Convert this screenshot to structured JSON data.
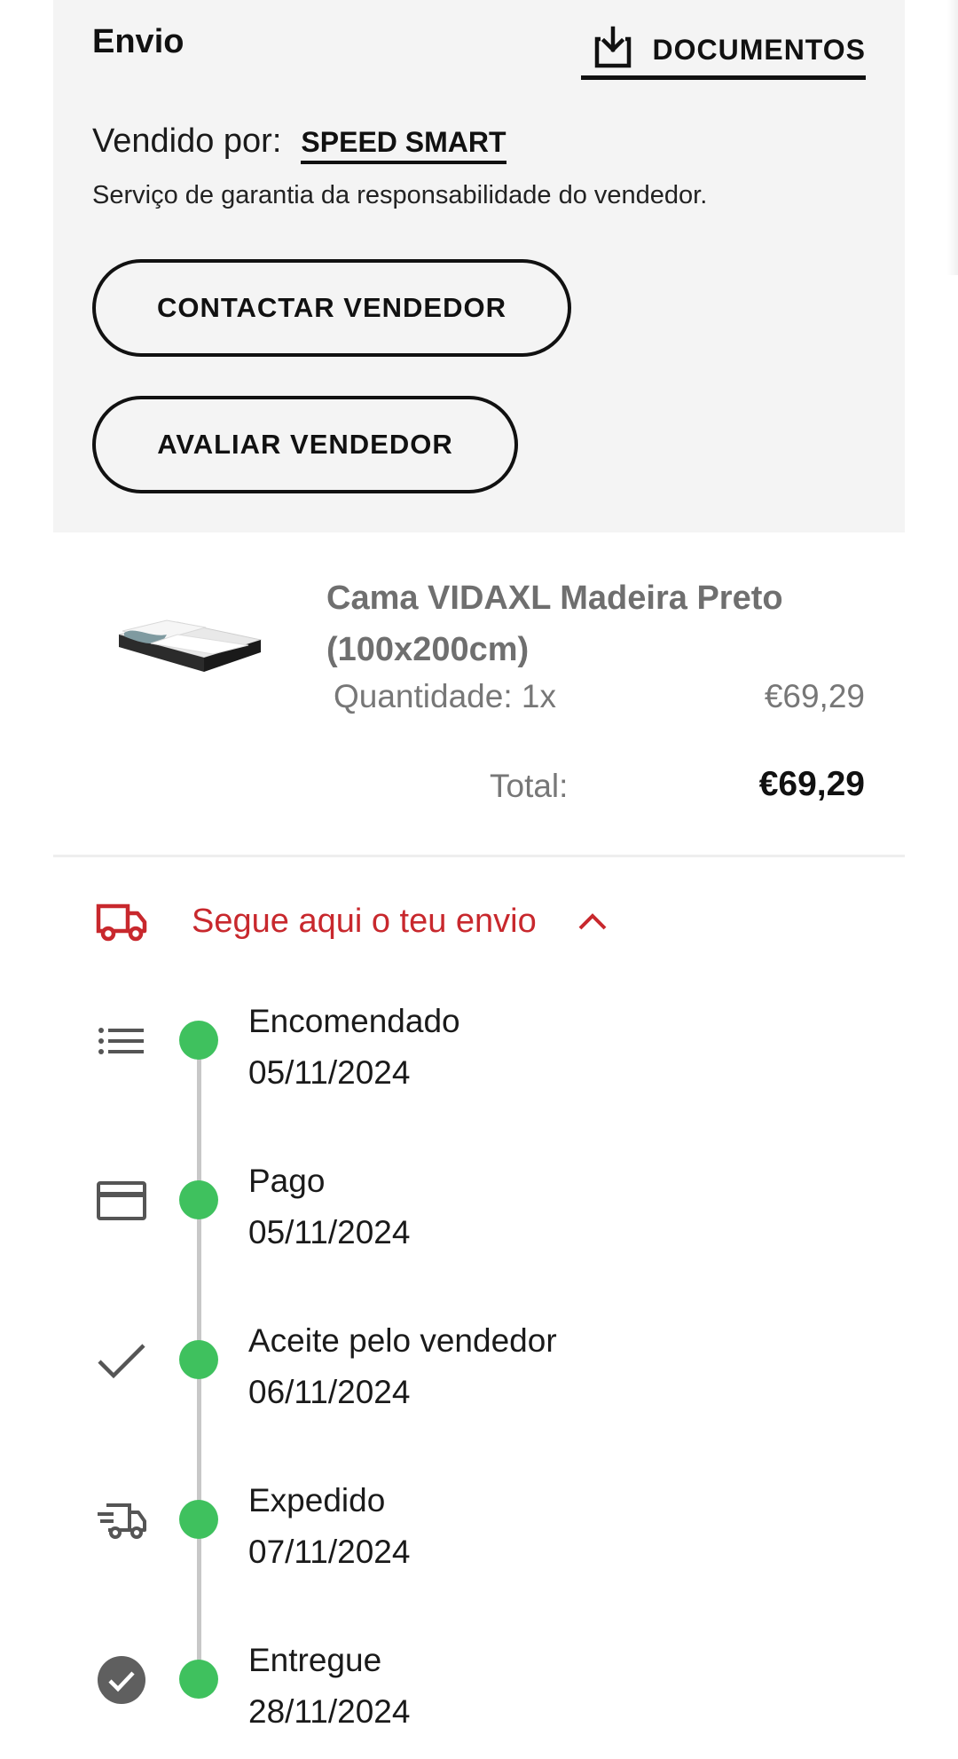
{
  "shipment": {
    "title": "Envio",
    "documents_label": "DOCUMENTOS",
    "sold_by_label": "Vendido por:",
    "seller_name": "SPEED SMART",
    "warranty_text": "Serviço de garantia da responsabilidade do vendedor.",
    "contact_button": "CONTACTAR VENDEDOR",
    "rate_button": "AVALIAR VENDEDOR"
  },
  "product": {
    "title": "Cama VIDAXL Madeira Preto (100x200cm)",
    "quantity": "Quantidade: 1x",
    "unit_price": "€69,29",
    "total_label": "Total:",
    "total_value": "€69,29"
  },
  "tracking": {
    "toggle_label": "Segue aqui o teu envio",
    "accent_color": "#c8282d",
    "dot_color": "#3fc15e",
    "steps": [
      {
        "icon": "list-icon",
        "name": "Encomendado",
        "date": "05/11/2024"
      },
      {
        "icon": "credit-card-icon",
        "name": "Pago",
        "date": "05/11/2024"
      },
      {
        "icon": "checkmark-icon",
        "name": "Aceite pelo vendedor",
        "date": "06/11/2024"
      },
      {
        "icon": "fast-truck-icon",
        "name": "Expedido",
        "date": "07/11/2024"
      },
      {
        "icon": "check-circle-icon",
        "name": "Entregue",
        "date": "28/11/2024"
      }
    ]
  }
}
